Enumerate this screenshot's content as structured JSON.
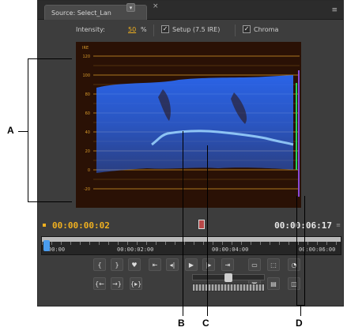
{
  "panel": {
    "tab_label": "Source: Select_Lan",
    "tab_caret": "▾",
    "tab_close": "×",
    "panel_menu": "≡"
  },
  "options": {
    "intensity_label": "Intensity:",
    "intensity_value": "50",
    "intensity_unit": "%",
    "setup_label": "Setup (7.5 IRE)",
    "setup_checked": true,
    "chroma_label": "Chroma",
    "chroma_checked": true
  },
  "scope": {
    "scale_unit": "IRE",
    "scale_labels": [
      "120",
      "100",
      "80",
      "60",
      "40",
      "20",
      "0",
      "-20"
    ],
    "colors": {
      "background": "#2a1105",
      "gridline": "#d89a2a",
      "trace": "#2a6cff",
      "trace_bright": "#9ed6ff",
      "chroma_bar_green": "#27d35a",
      "chroma_bar_purple": "#8a4ad8"
    }
  },
  "transport": {
    "current_time": "00:00:00:02",
    "duration": "00:00:06:17",
    "timeline_labels": [
      "00:00",
      "00:00:02:00",
      "00:00:04:00",
      "00:00:06:00"
    ],
    "buttons": [
      {
        "name": "mark-in-button",
        "glyph": "{"
      },
      {
        "name": "mark-out-button",
        "glyph": "}"
      },
      {
        "name": "set-marker-button",
        "glyph": "♥"
      },
      {
        "name": "go-to-in-button",
        "glyph": "⇤"
      },
      {
        "name": "step-back-button",
        "glyph": "◂|"
      },
      {
        "name": "play-button",
        "glyph": "▶"
      },
      {
        "name": "step-forward-button",
        "glyph": "|▸"
      },
      {
        "name": "go-to-out-button",
        "glyph": "⇥"
      },
      {
        "name": "output-button",
        "glyph": "▭"
      },
      {
        "name": "safe-margins-button",
        "glyph": "⬚"
      },
      {
        "name": "settings-button",
        "glyph": "◔"
      },
      {
        "name": "go-to-prev-marker-button",
        "glyph": "{←"
      },
      {
        "name": "go-to-next-marker-button",
        "glyph": "→}"
      },
      {
        "name": "play-in-to-out-button",
        "glyph": "{▸}"
      },
      {
        "name": "insert-button",
        "glyph": "▣"
      },
      {
        "name": "overlay-button",
        "glyph": "▤"
      },
      {
        "name": "export-frame-button",
        "glyph": "◫"
      }
    ]
  },
  "callouts": {
    "a": "A",
    "b": "B",
    "c": "C",
    "d": "D"
  }
}
